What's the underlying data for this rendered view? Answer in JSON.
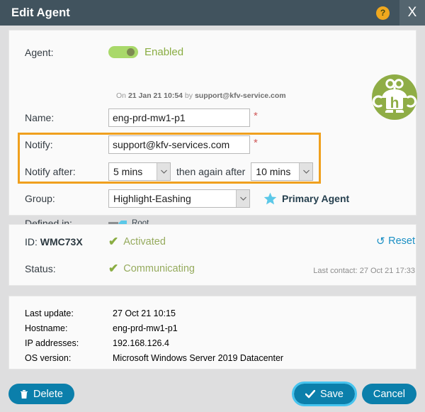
{
  "window": {
    "title": "Edit Agent",
    "help_icon": "question-mark-icon",
    "close_label": "X"
  },
  "form": {
    "agent": {
      "label": "Agent:",
      "toggle_state": "Enabled",
      "toggle_on": true,
      "meta_prefix": "On ",
      "meta_datetime": "21 Jan 21 10:54",
      "meta_by": " by ",
      "meta_user": "support@kfv-service.com"
    },
    "name": {
      "label": "Name:",
      "value": "eng-prd-mw1-p1",
      "required_mark": "*"
    },
    "notify": {
      "label": "Notify:",
      "value": "support@kfv-services.com",
      "required_mark": "*"
    },
    "notify_after": {
      "label": "Notify after:",
      "first_value": "5 mins",
      "middle_text": "then again after",
      "second_value": "10 mins"
    },
    "group": {
      "label": "Group:",
      "value": "Highlight-Eashing",
      "primary_label": "Primary Agent"
    },
    "defined_in": {
      "label": "Defined in:",
      "value": "Root"
    }
  },
  "status_panel": {
    "id_label": "ID:",
    "id_value": "WMC73X",
    "activation": "Activated",
    "reset_label": "Reset",
    "status_label": "Status:",
    "status_value": "Communicating",
    "last_contact": "Last contact: 27 Oct 21 17:33"
  },
  "info_panel": {
    "rows": [
      {
        "key": "Last update:",
        "value": "27 Oct 21 10:15"
      },
      {
        "key": "Hostname:",
        "value": "eng-prd-mw1-p1"
      },
      {
        "key": "IP addresses:",
        "value": "192.168.126.4"
      },
      {
        "key": "OS version:",
        "value": "Microsoft Windows Server 2019 Datacenter"
      }
    ]
  },
  "footer": {
    "delete_label": "Delete",
    "save_label": "Save",
    "cancel_label": "Cancel"
  },
  "colors": {
    "titlebar": "#41535e",
    "accent_blue": "#0b7fab",
    "highlight_orange": "#f0a01e",
    "status_green": "#8aad43",
    "toggle_green": "#a9d96a",
    "star_blue": "#5bc8e8",
    "avatar_green": "#8fad46"
  }
}
